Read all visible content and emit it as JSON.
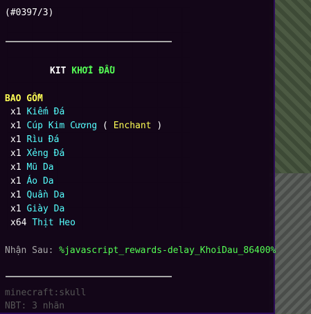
{
  "tooltip": {
    "id_line": "(#0397/3)",
    "title_prefix": "KIT ",
    "title_main": "KHỞI ĐẦU",
    "includes_header": "BAO GỒM",
    "items": [
      {
        "qty": "x1 ",
        "name": "Kiếm Đá",
        "extra": null
      },
      {
        "qty": "x1 ",
        "name": "Cúp Kim Cương",
        "extra": {
          "open": " ( ",
          "label": "Enchant",
          "close": " )"
        }
      },
      {
        "qty": "x1 ",
        "name": "Rìu Đá",
        "extra": null
      },
      {
        "qty": "x1 ",
        "name": "Xẻng Đá",
        "extra": null
      },
      {
        "qty": "x1 ",
        "name": "Mũ Da",
        "extra": null
      },
      {
        "qty": "x1 ",
        "name": "Áo Da",
        "extra": null
      },
      {
        "qty": "x1 ",
        "name": "Quần Da",
        "extra": null
      },
      {
        "qty": "x1 ",
        "name": "Giày Da",
        "extra": null
      },
      {
        "qty": "x64 ",
        "name": "Thịt Heo",
        "extra": null
      }
    ],
    "receive_label": "Nhận Sau: ",
    "receive_value": "%javascript_rewards-delay_KhoiDau_86400%",
    "item_id": "minecraft:skull",
    "nbt": "NBT: 3 nhãn"
  },
  "colors": {
    "title_prefix": "#ffffff",
    "title_main": "#55ff55",
    "header": "#ffff55",
    "item_name": "#55ffff",
    "enchant": "#ffaa00",
    "receive_value": "#55ff55",
    "meta": "#555555"
  }
}
